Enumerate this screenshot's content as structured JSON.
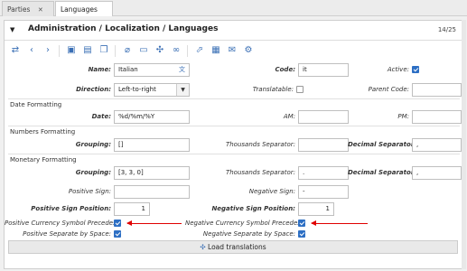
{
  "tabs": [
    {
      "label": "Parties"
    },
    {
      "label": "Languages"
    }
  ],
  "header": {
    "title": "Administration / Localization / Languages",
    "pager": "14/25"
  },
  "toolbar": {
    "icons": [
      "switch-icon",
      "prev-icon",
      "next-icon",
      "new-icon",
      "save-icon",
      "copy-icon",
      "attach-icon",
      "note-icon",
      "relate-icon",
      "link-icon",
      "open-icon",
      "print-icon",
      "email-icon",
      "action-icon"
    ]
  },
  "form": {
    "name_label": "Name:",
    "name_value": "Italian",
    "code_label": "Code:",
    "code_value": "it",
    "active_label": "Active:",
    "direction_label": "Direction:",
    "direction_value": "Left-to-right",
    "translatable_label": "Translatable:",
    "parent_code_label": "Parent Code:",
    "date_section": "Date Formatting",
    "date_label": "Date:",
    "date_value": "%d/%m/%Y",
    "am_label": "AM:",
    "pm_label": "PM:",
    "numbers_section": "Numbers Formatting",
    "grouping_label": "Grouping:",
    "grouping_value": "[]",
    "thousands_label": "Thousands Separator:",
    "decimal_label": "Decimal Separator:",
    "decimal_value": ",",
    "monetary_section": "Monetary Formatting",
    "m_grouping_label": "Grouping:",
    "m_grouping_value": "[3, 3, 0]",
    "m_thousands_label": "Thousands Separator:",
    "m_thousands_value": ".",
    "m_decimal_label": "Decimal Separator:",
    "m_decimal_value": ",",
    "pos_sign_label": "Positive Sign:",
    "neg_sign_label": "Negative Sign:",
    "neg_sign_value": "-",
    "pos_sign_pos_label": "Positive Sign Position:",
    "pos_sign_pos_value": "1",
    "neg_sign_pos_label": "Negative Sign Position:",
    "neg_sign_pos_value": "1",
    "pos_cur_label": "Positive Currency Symbol Precedes:",
    "neg_cur_label": "Negative Currency Symbol Precedes:",
    "pos_space_label": "Positive Separate by Space:",
    "neg_space_label": "Negative Separate by Space:"
  },
  "load_button": "Load translations",
  "colors": {
    "accent": "#2d6fc4",
    "arrow": "#e00000"
  }
}
